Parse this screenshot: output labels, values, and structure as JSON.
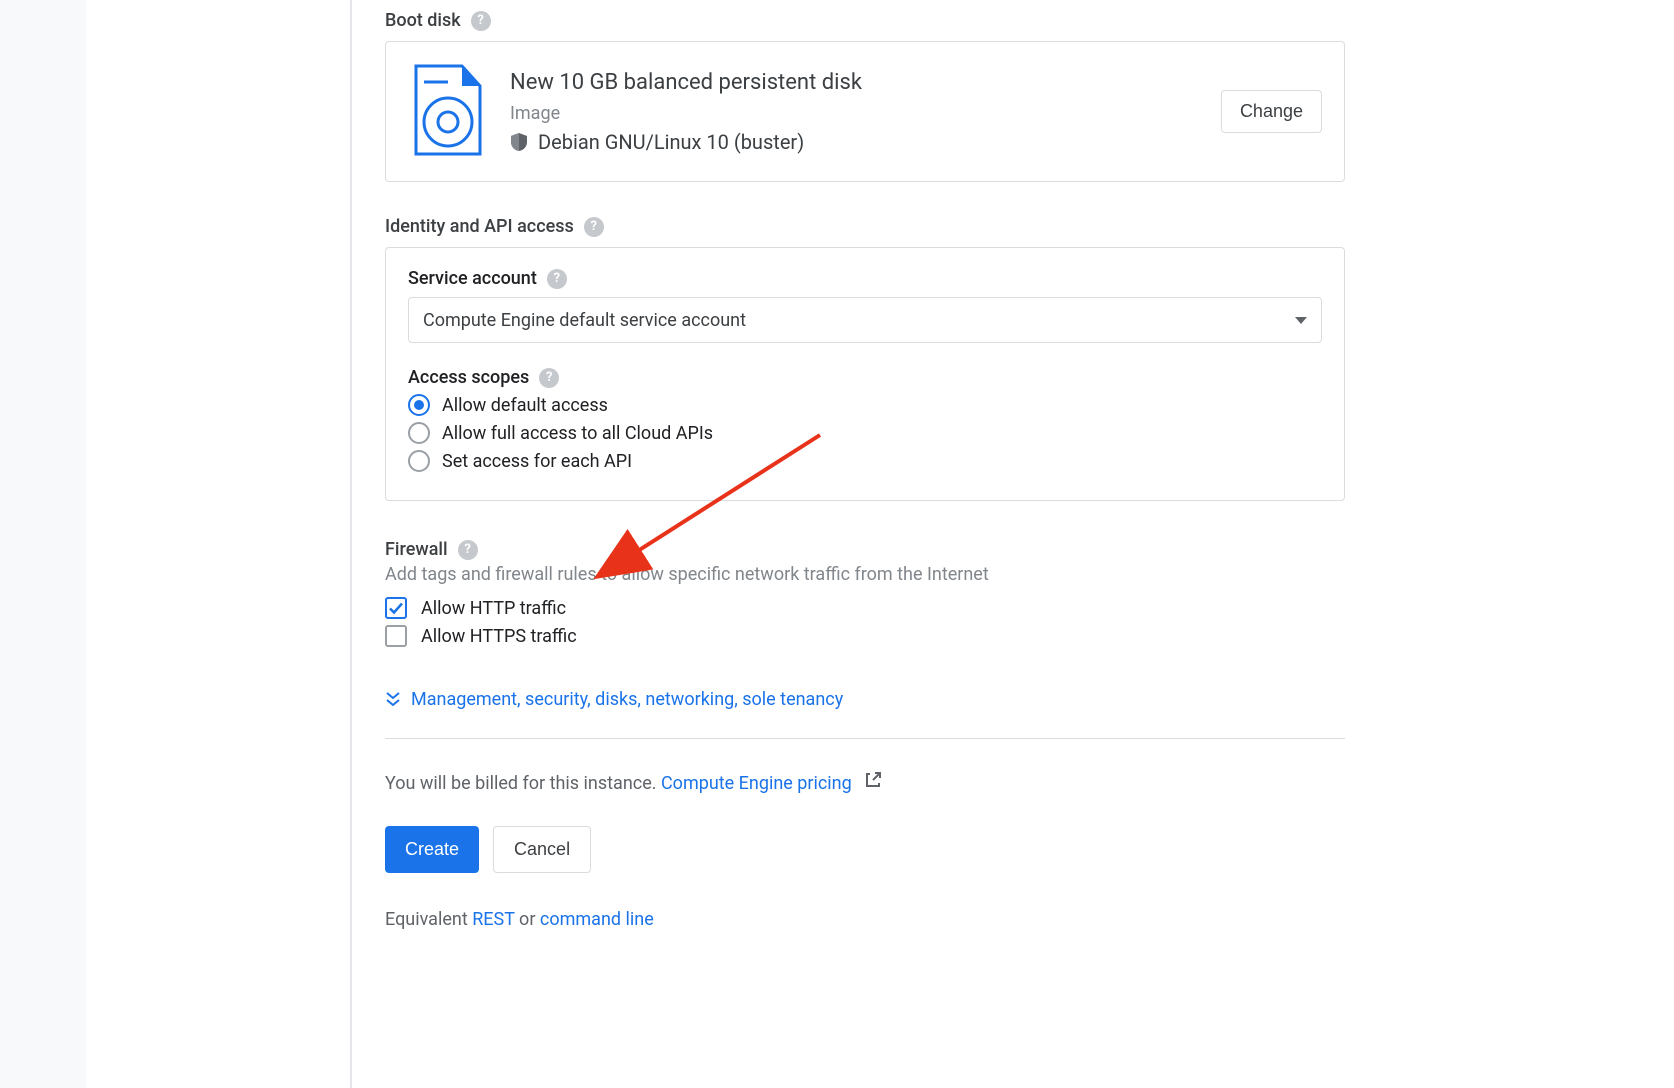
{
  "boot_disk": {
    "title": "Boot disk",
    "summary": "New 10 GB balanced persistent disk",
    "image_label": "Image",
    "os": "Debian GNU/Linux 10 (buster)",
    "change": "Change"
  },
  "identity": {
    "title": "Identity and API access",
    "service_account_label": "Service account",
    "service_account_value": "Compute Engine default service account",
    "access_scopes_label": "Access scopes",
    "scopes": {
      "default": "Allow default access",
      "full": "Allow full access to all Cloud APIs",
      "each": "Set access for each API"
    }
  },
  "firewall": {
    "title": "Firewall",
    "desc": "Add tags and firewall rules to allow specific network traffic from the Internet",
    "http": "Allow HTTP traffic",
    "https": "Allow HTTPS traffic"
  },
  "expander": "Management, security, disks, networking, sole tenancy",
  "billing": {
    "prefix": "You will be billed for this instance. ",
    "link": "Compute Engine pricing"
  },
  "buttons": {
    "create": "Create",
    "cancel": "Cancel"
  },
  "equivalent": {
    "prefix": "Equivalent ",
    "rest": "REST",
    "mid": " or ",
    "cmd": "command line"
  },
  "help_glyph": "?"
}
